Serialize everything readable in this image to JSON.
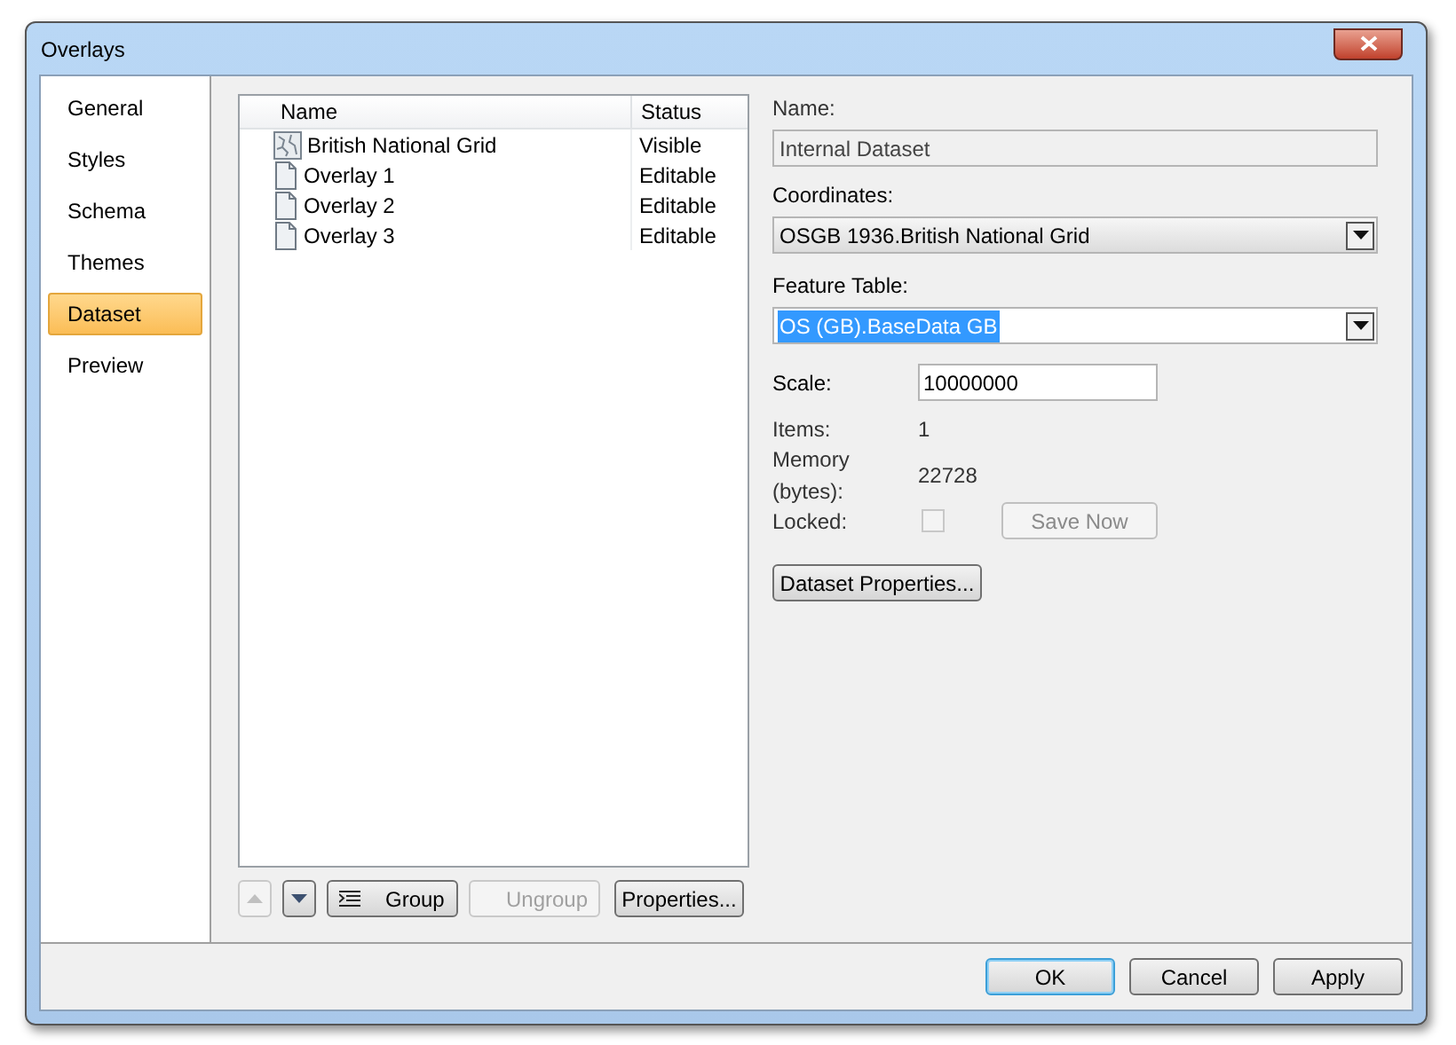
{
  "window": {
    "title": "Overlays"
  },
  "nav": [
    {
      "label": "General",
      "selected": false
    },
    {
      "label": "Styles",
      "selected": false
    },
    {
      "label": "Schema",
      "selected": false
    },
    {
      "label": "Themes",
      "selected": false
    },
    {
      "label": "Dataset",
      "selected": true
    },
    {
      "label": "Preview",
      "selected": false
    }
  ],
  "list": {
    "columns": [
      "Name",
      "Status"
    ],
    "rows": [
      {
        "kind": "map",
        "name": "British National Grid",
        "status": "Visible"
      },
      {
        "kind": "document",
        "name": "Overlay 1",
        "status": "Editable"
      },
      {
        "kind": "document",
        "name": "Overlay 2",
        "status": "Editable"
      },
      {
        "kind": "document",
        "name": "Overlay 3",
        "status": "Editable"
      }
    ]
  },
  "list_buttons": [
    {
      "kind": "up",
      "disabled": true
    },
    {
      "kind": "down",
      "disabled": false
    },
    {
      "kind": "group",
      "label": "Group",
      "disabled": false
    },
    {
      "kind": "ungroup",
      "label": "Ungroup",
      "disabled": true
    },
    {
      "kind": "text",
      "label": "Properties...",
      "disabled": false
    }
  ],
  "form": {
    "name_label": "Name:",
    "name_value": "Internal Dataset",
    "coordinates_label": "Coordinates:",
    "coordinates_value": "OSGB 1936.British National Grid",
    "feature_table_label": "Feature Table:",
    "feature_table_value": "OS (GB).BaseData GB",
    "scale_label": "Scale:",
    "scale_value": "10000000",
    "items_label": "Items:",
    "items_value": "1",
    "memory_label": "Memory (bytes):",
    "memory_value": "22728",
    "locked_label": "Locked:",
    "locked": {
      "checked": false,
      "disabled": true
    },
    "save_now": {
      "label": "Save Now",
      "disabled": true
    },
    "dataset_properties": {
      "label": "Dataset Properties...",
      "disabled": false
    }
  },
  "footer_buttons": [
    {
      "label": "OK",
      "default": true
    },
    {
      "label": "Cancel",
      "default": false
    },
    {
      "label": "Apply",
      "default": false
    }
  ]
}
